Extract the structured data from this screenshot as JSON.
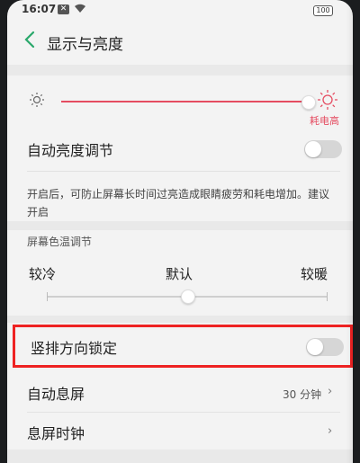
{
  "status": {
    "time": "16:07",
    "notif_icon": "x-notification-icon",
    "battery": "100"
  },
  "header": {
    "title": "显示与亮度"
  },
  "brightness": {
    "level": 0.97,
    "high_label": "耗电高"
  },
  "auto_brightness": {
    "label": "自动亮度调节",
    "enabled": false
  },
  "description": "开启后，可防止屏幕长时间过亮造成眼睛疲劳和耗电增加。建议开启",
  "color_temp": {
    "section_title": "屏幕色温调节",
    "left_label": "较冷",
    "center_label": "默认",
    "right_label": "较暖",
    "level": 0.5
  },
  "orientation_lock": {
    "label": "竖排方向锁定",
    "enabled": false
  },
  "auto_screen_off": {
    "label": "自动息屏",
    "value": "30 分钟"
  },
  "screen_off_clock": {
    "label": "息屏时钟"
  },
  "colors": {
    "accent": "#e54c61",
    "highlight": "#ee2222"
  }
}
